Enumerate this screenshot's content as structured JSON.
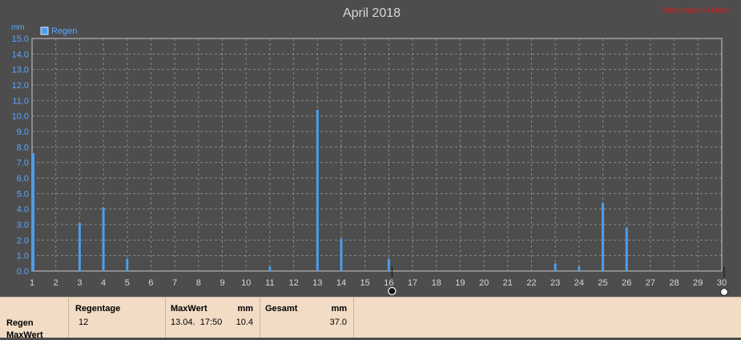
{
  "chart_data": {
    "type": "bar",
    "title": "April 2018",
    "watermark": "Wetterstation Hebe",
    "ylabel": "mm",
    "ylim": [
      0,
      15
    ],
    "yticks": [
      "0.0",
      "1.0",
      "2.0",
      "3.0",
      "4.0",
      "5.0",
      "6.0",
      "7.0",
      "8.0",
      "9.0",
      "10.0",
      "11.0",
      "12.0",
      "13.0",
      "14.0",
      "15.0"
    ],
    "x_range": [
      1,
      30
    ],
    "categories": [
      1,
      2,
      3,
      4,
      5,
      6,
      7,
      8,
      9,
      10,
      11,
      12,
      13,
      14,
      15,
      16,
      17,
      18,
      19,
      20,
      21,
      22,
      23,
      24,
      25,
      26,
      27,
      28,
      29,
      30
    ],
    "series": [
      {
        "name": "Regen",
        "color": "#4a9ef0",
        "x": [
          1,
          3,
          4,
          5,
          11,
          13,
          14,
          16,
          23,
          24,
          25,
          26
        ],
        "values": [
          7.6,
          3.1,
          4.1,
          0.8,
          0.3,
          10.4,
          2.1,
          0.8,
          0.5,
          0.3,
          4.4,
          2.8
        ]
      }
    ],
    "grid": true,
    "legend": "top-left"
  },
  "summary": {
    "row_labels": [
      "Regen",
      "MaxWert"
    ],
    "regentage_header": "Regentage",
    "regentage_value": "12",
    "maxwert_header": "MaxWert",
    "maxwert_unit": "mm",
    "maxwert_datetime": "13.04.  17:50",
    "maxwert_value": "10.4",
    "gesamt_header": "Gesamt",
    "gesamt_unit": "mm",
    "gesamt_value": "37.0"
  }
}
